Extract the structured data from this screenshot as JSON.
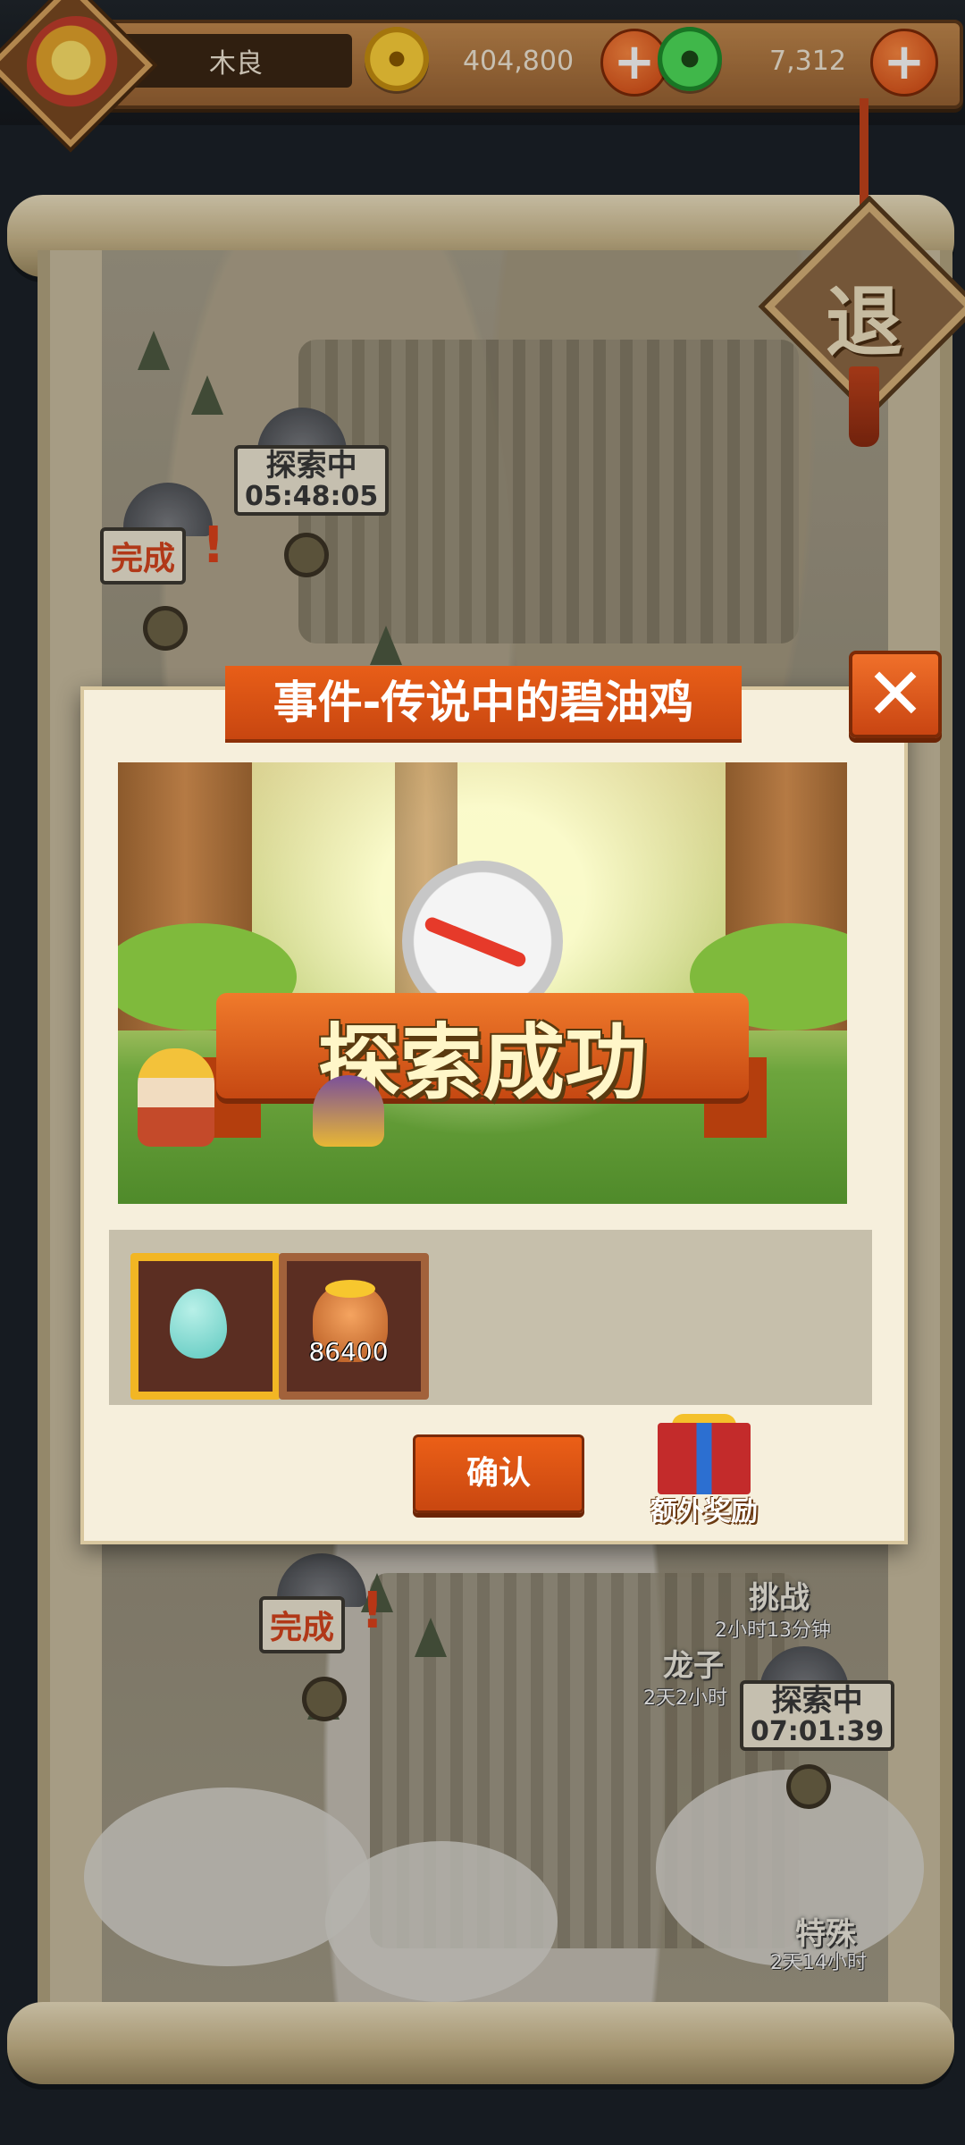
{
  "hud": {
    "player_name": "木良",
    "gold_amount": "404,800",
    "jade_amount": "7,312",
    "avatar_icon": "monkey-king-avatar",
    "gold_icon": "copper-coin-icon",
    "jade_icon": "jade-coin-icon",
    "plus_icon": "plus-icon"
  },
  "exit": {
    "label": "退"
  },
  "map": {
    "node_top_done": {
      "label": "完成",
      "mark": "!"
    },
    "node_top_exploring": {
      "label": "探索中",
      "time": "05:48:05"
    },
    "node_bottom_done": {
      "label": "完成",
      "mark": "!"
    },
    "node_bottom_exploring": {
      "label": "探索中",
      "time": "07:01:39"
    },
    "challenge": {
      "label": "挑战",
      "time": "2小时13分钟"
    },
    "dragon": {
      "label": "龙子",
      "time": "2天2小时"
    },
    "special": {
      "label": "特殊",
      "time": "2天14小时"
    }
  },
  "dialog": {
    "title": "事件-传说中的碧油鸡",
    "banner_text": "探索成功",
    "rewards": [
      {
        "icon": "spirit-egg-icon",
        "count": ""
      },
      {
        "icon": "gold-bag-icon",
        "count": "86400"
      }
    ],
    "confirm_label": "确认",
    "bonus_label": "额外奖励",
    "close_icon": "close-icon",
    "bonus_icon": "gift-box-icon"
  },
  "colors": {
    "accent_orange": "#e0541a",
    "parchment": "#f6efdc",
    "gold_frame": "#f2b624",
    "wood_frame": "#a2623b"
  }
}
